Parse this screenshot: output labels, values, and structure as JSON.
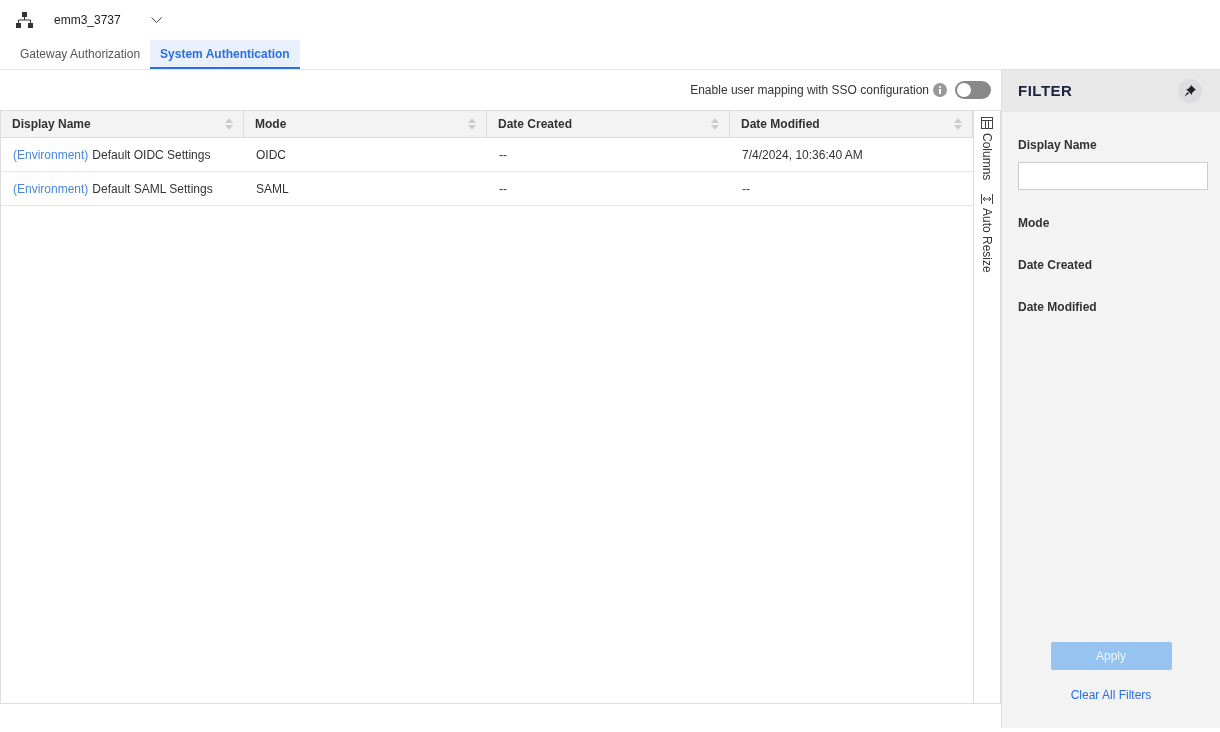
{
  "header": {
    "environment": "emm3_3737"
  },
  "tabs": [
    {
      "label": "Gateway Authorization",
      "selected": false
    },
    {
      "label": "System Authentication",
      "selected": true
    }
  ],
  "toolbar": {
    "sso_toggle_label": "Enable user mapping with SSO configuration",
    "sso_toggle_on": false
  },
  "table": {
    "columns": [
      "Display Name",
      "Mode",
      "Date Created",
      "Date Modified"
    ],
    "rows": [
      {
        "prefix": "(Environment)",
        "name": "Default OIDC Settings",
        "mode": "OIDC",
        "date_created": "--",
        "date_modified": "7/4/2024, 10:36:40 AM"
      },
      {
        "prefix": "(Environment)",
        "name": "Default SAML Settings",
        "mode": "SAML",
        "date_created": "--",
        "date_modified": "--"
      }
    ]
  },
  "side_bar": [
    "Columns",
    "Auto Resize"
  ],
  "filter": {
    "title": "FILTER",
    "fields": [
      {
        "label": "Display Name",
        "kind": "text"
      },
      {
        "label": "Mode",
        "kind": "label"
      },
      {
        "label": "Date Created",
        "kind": "label"
      },
      {
        "label": "Date Modified",
        "kind": "label"
      }
    ],
    "apply": {
      "label": "Apply",
      "disabled": true
    },
    "clear": "Clear All Filters"
  }
}
